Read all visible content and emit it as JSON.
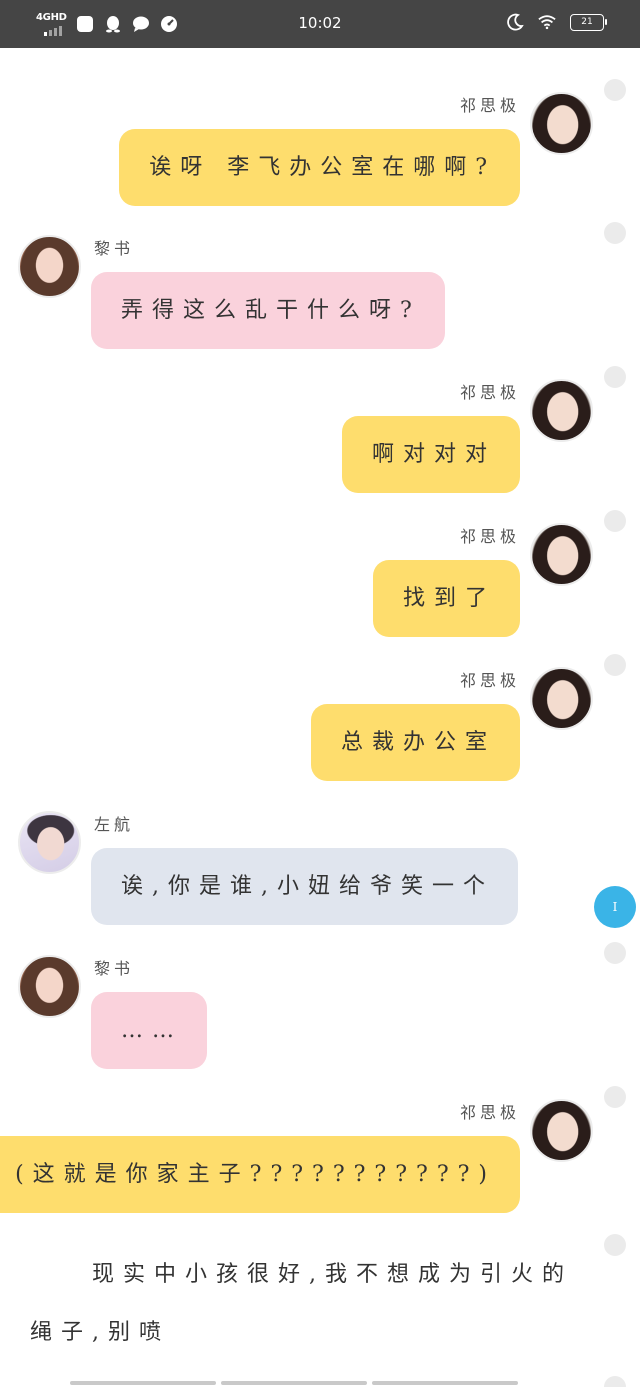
{
  "status_bar": {
    "network": "4GHD",
    "time": "10:02",
    "battery": "21"
  },
  "messages": [
    {
      "sender": "祁思极",
      "text": "诶呀 李飞办公室在哪啊?"
    },
    {
      "sender": "黎书",
      "text": "弄得这么乱干什么呀?"
    },
    {
      "sender": "祁思极",
      "text": "啊对对对"
    },
    {
      "sender": "祁思极",
      "text": "找到了"
    },
    {
      "sender": "祁思极",
      "text": "总裁办公室"
    },
    {
      "sender": "左航",
      "text": "诶,你是谁,小妞给爷笑一个"
    },
    {
      "sender": "黎书",
      "text": "……"
    },
    {
      "sender": "祁思极",
      "text": "(这就是你家主子???????????)"
    }
  ],
  "narration": "现实中小孩很好,我不想成为引火的绳子,别喷",
  "fab_label": "I",
  "colors": {
    "self_bubble": "#fedd6d",
    "li_bubble": "#fad2dc",
    "zuo_bubble": "#e0e5ee",
    "status_bar": "#454545",
    "fab": "#3ab4e7"
  }
}
